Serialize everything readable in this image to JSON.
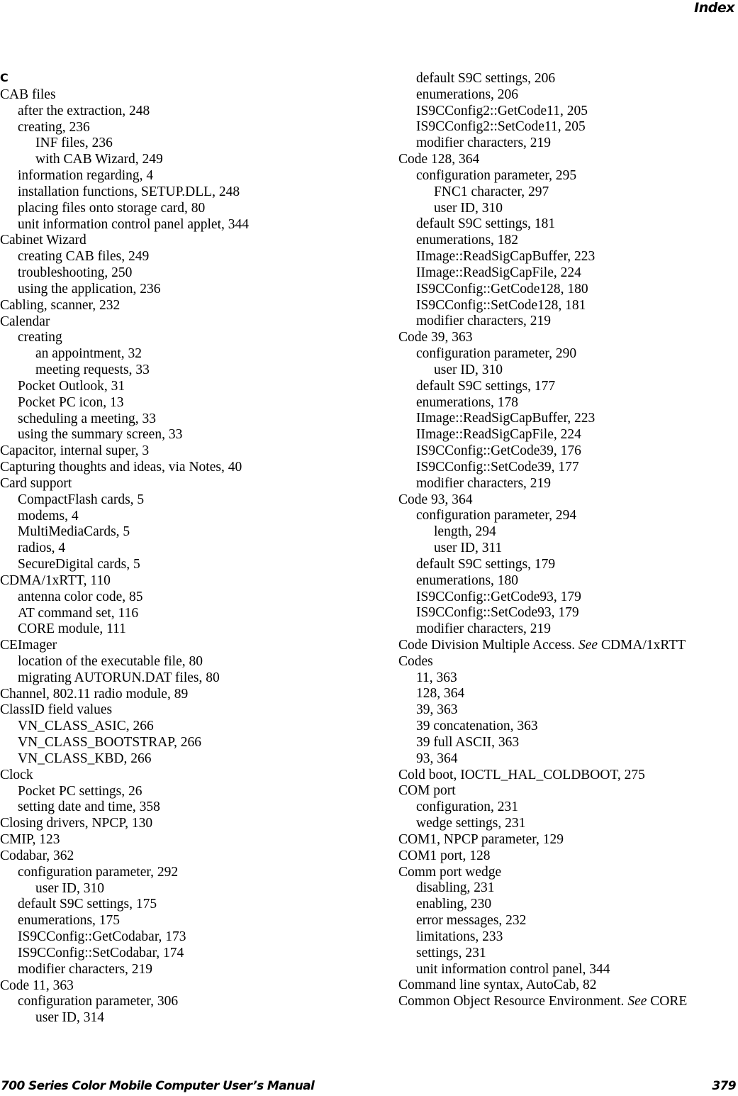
{
  "header": {
    "running_head": "Index"
  },
  "left_column": {
    "letter_heading": "C",
    "entries": [
      {
        "level": 0,
        "text": "CAB files"
      },
      {
        "level": 1,
        "text": "after the extraction, 248"
      },
      {
        "level": 1,
        "text": "creating, 236"
      },
      {
        "level": 2,
        "text": "INF files, 236"
      },
      {
        "level": 2,
        "text": "with CAB Wizard, 249"
      },
      {
        "level": 1,
        "text": "information regarding, 4"
      },
      {
        "level": 1,
        "text": "installation functions, SETUP.DLL, 248"
      },
      {
        "level": 1,
        "text": "placing files onto storage card, 80"
      },
      {
        "level": 1,
        "text": "unit information control panel applet, 344"
      },
      {
        "level": 0,
        "text": "Cabinet Wizard"
      },
      {
        "level": 1,
        "text": "creating CAB files, 249"
      },
      {
        "level": 1,
        "text": "troubleshooting, 250"
      },
      {
        "level": 1,
        "text": "using the application, 236"
      },
      {
        "level": 0,
        "text": "Cabling, scanner, 232"
      },
      {
        "level": 0,
        "text": "Calendar"
      },
      {
        "level": 1,
        "text": "creating"
      },
      {
        "level": 2,
        "text": "an appointment, 32"
      },
      {
        "level": 2,
        "text": "meeting requests, 33"
      },
      {
        "level": 1,
        "text": "Pocket Outlook, 31"
      },
      {
        "level": 1,
        "text": "Pocket PC icon, 13"
      },
      {
        "level": 1,
        "text": "scheduling a meeting, 33"
      },
      {
        "level": 1,
        "text": "using the summary screen, 33"
      },
      {
        "level": 0,
        "text": "Capacitor, internal super, 3"
      },
      {
        "level": 0,
        "text": "Capturing thoughts and ideas, via Notes, 40"
      },
      {
        "level": 0,
        "text": "Card support"
      },
      {
        "level": 1,
        "text": "CompactFlash cards, 5"
      },
      {
        "level": 1,
        "text": "modems, 4"
      },
      {
        "level": 1,
        "text": "MultiMediaCards, 5"
      },
      {
        "level": 1,
        "text": "radios, 4"
      },
      {
        "level": 1,
        "text": "SecureDigital cards, 5"
      },
      {
        "level": 0,
        "text": "CDMA/1xRTT, 110"
      },
      {
        "level": 1,
        "text": "antenna color code, 85"
      },
      {
        "level": 1,
        "text": "AT command set, 116"
      },
      {
        "level": 1,
        "text": "CORE module, 111"
      },
      {
        "level": 0,
        "text": "CEImager"
      },
      {
        "level": 1,
        "text": "location of the executable file, 80"
      },
      {
        "level": 1,
        "text": "migrating AUTORUN.DAT files, 80"
      },
      {
        "level": 0,
        "text": "Channel, 802.11 radio module, 89"
      },
      {
        "level": 0,
        "text": "ClassID field values"
      },
      {
        "level": 1,
        "text": "VN_CLASS_ASIC, 266"
      },
      {
        "level": 1,
        "text": "VN_CLASS_BOOTSTRAP, 266"
      },
      {
        "level": 1,
        "text": "VN_CLASS_KBD, 266"
      },
      {
        "level": 0,
        "text": "Clock"
      },
      {
        "level": 1,
        "text": "Pocket PC settings, 26"
      },
      {
        "level": 1,
        "text": "setting date and time, 358"
      },
      {
        "level": 0,
        "text": "Closing drivers, NPCP, 130"
      },
      {
        "level": 0,
        "text": "CMIP, 123"
      },
      {
        "level": 0,
        "text": "Codabar, 362"
      },
      {
        "level": 1,
        "text": "configuration parameter, 292"
      },
      {
        "level": 2,
        "text": "user ID, 310"
      },
      {
        "level": 1,
        "text": "default S9C settings, 175"
      },
      {
        "level": 1,
        "text": "enumerations, 175"
      },
      {
        "level": 1,
        "text": "IS9CConfig::GetCodabar, 173"
      },
      {
        "level": 1,
        "text": "IS9CConfig::SetCodabar, 174"
      },
      {
        "level": 1,
        "text": "modifier characters, 219"
      },
      {
        "level": 0,
        "text": "Code 11, 363"
      },
      {
        "level": 1,
        "text": "configuration parameter, 306"
      },
      {
        "level": 2,
        "text": "user ID, 314"
      }
    ]
  },
  "right_column": {
    "entries": [
      {
        "level": 1,
        "text": "default S9C settings, 206"
      },
      {
        "level": 1,
        "text": "enumerations, 206"
      },
      {
        "level": 1,
        "text": "IS9CConfig2::GetCode11, 205"
      },
      {
        "level": 1,
        "text": "IS9CConfig2::SetCode11, 205"
      },
      {
        "level": 1,
        "text": "modifier characters, 219"
      },
      {
        "level": 0,
        "text": "Code 128, 364"
      },
      {
        "level": 1,
        "text": "configuration parameter, 295"
      },
      {
        "level": 2,
        "text": "FNC1 character, 297"
      },
      {
        "level": 2,
        "text": "user ID, 310"
      },
      {
        "level": 1,
        "text": "default S9C settings, 181"
      },
      {
        "level": 1,
        "text": "enumerations, 182"
      },
      {
        "level": 1,
        "text": "IImage::ReadSigCapBuffer, 223"
      },
      {
        "level": 1,
        "text": "IImage::ReadSigCapFile, 224"
      },
      {
        "level": 1,
        "text": "IS9CConfig::GetCode128, 180"
      },
      {
        "level": 1,
        "text": "IS9CConfig::SetCode128, 181"
      },
      {
        "level": 1,
        "text": "modifier characters, 219"
      },
      {
        "level": 0,
        "text": "Code 39, 363"
      },
      {
        "level": 1,
        "text": "configuration parameter, 290"
      },
      {
        "level": 2,
        "text": "user ID, 310"
      },
      {
        "level": 1,
        "text": "default S9C settings, 177"
      },
      {
        "level": 1,
        "text": "enumerations, 178"
      },
      {
        "level": 1,
        "text": "IImage::ReadSigCapBuffer, 223"
      },
      {
        "level": 1,
        "text": "IImage::ReadSigCapFile, 224"
      },
      {
        "level": 1,
        "text": "IS9CConfig::GetCode39, 176"
      },
      {
        "level": 1,
        "text": "IS9CConfig::SetCode39, 177"
      },
      {
        "level": 1,
        "text": "modifier characters, 219"
      },
      {
        "level": 0,
        "text": "Code 93, 364"
      },
      {
        "level": 1,
        "text": "configuration parameter, 294"
      },
      {
        "level": 2,
        "text": "length, 294"
      },
      {
        "level": 2,
        "text": "user ID, 311"
      },
      {
        "level": 1,
        "text": "default S9C settings, 179"
      },
      {
        "level": 1,
        "text": "enumerations, 180"
      },
      {
        "level": 1,
        "text": "IS9CConfig::GetCode93, 179"
      },
      {
        "level": 1,
        "text": "IS9CConfig::SetCode93, 179"
      },
      {
        "level": 1,
        "text": "modifier characters, 219"
      },
      {
        "level": 0,
        "text": "Code Division Multiple Access.",
        "see": "See",
        "see_target": "CDMA/1xRTT"
      },
      {
        "level": 0,
        "text": "Codes"
      },
      {
        "level": 1,
        "text": "11, 363"
      },
      {
        "level": 1,
        "text": "128, 364"
      },
      {
        "level": 1,
        "text": "39, 363"
      },
      {
        "level": 1,
        "text": "39 concatenation, 363"
      },
      {
        "level": 1,
        "text": "39 full ASCII, 363"
      },
      {
        "level": 1,
        "text": "93, 364"
      },
      {
        "level": 0,
        "text": "Cold boot, IOCTL_HAL_COLDBOOT, 275"
      },
      {
        "level": 0,
        "text": "COM port"
      },
      {
        "level": 1,
        "text": "configuration, 231"
      },
      {
        "level": 1,
        "text": "wedge settings, 231"
      },
      {
        "level": 0,
        "text": "COM1, NPCP parameter, 129"
      },
      {
        "level": 0,
        "text": "COM1 port, 128"
      },
      {
        "level": 0,
        "text": "Comm port wedge"
      },
      {
        "level": 1,
        "text": "disabling, 231"
      },
      {
        "level": 1,
        "text": "enabling, 230"
      },
      {
        "level": 1,
        "text": "error messages, 232"
      },
      {
        "level": 1,
        "text": "limitations, 233"
      },
      {
        "level": 1,
        "text": "settings, 231"
      },
      {
        "level": 1,
        "text": "unit information control panel, 344"
      },
      {
        "level": 0,
        "text": "Command line syntax, AutoCab, 82"
      },
      {
        "level": 0,
        "text": "Common Object Resource Environment.",
        "see": "See",
        "see_target": "CORE"
      }
    ]
  },
  "footer": {
    "manual_title": "700 Series Color Mobile Computer User’s Manual",
    "page_number": "379"
  }
}
